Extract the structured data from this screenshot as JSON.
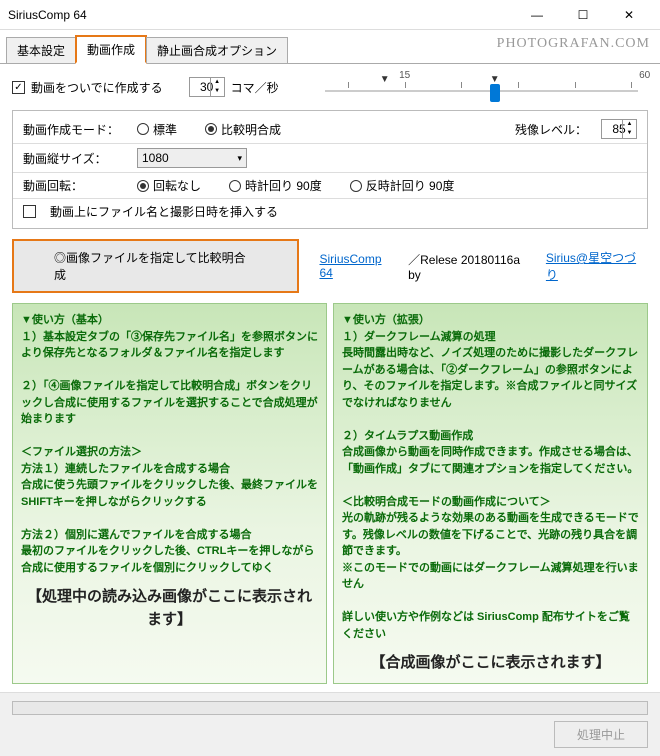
{
  "window": {
    "title": "SiriusComp 64"
  },
  "brand": "PHOTOGRAFAN.COM",
  "tabs": [
    "基本設定",
    "動画作成",
    "静止画合成オプション"
  ],
  "top": {
    "checkbox_label": "動画をついでに作成する",
    "fps_value": "30",
    "fps_unit": "コマ／秒"
  },
  "slider": {
    "labels": [
      "15",
      "60"
    ],
    "thumb_value": 30
  },
  "form": {
    "mode_label": "動画作成モード：",
    "mode_opts": [
      "標準",
      "比較明合成"
    ],
    "residue_label": "残像レベル：",
    "residue_value": "85",
    "size_label": "動画縦サイズ：",
    "size_value": "1080",
    "rotate_label": "動画回転：",
    "rotate_opts": [
      "回転なし",
      "時計回り 90度",
      "反時計回り 90度"
    ],
    "insert_label": "動画上にファイル名と撮影日時を挿入する"
  },
  "action": {
    "button": "◎画像ファイルを指定して比較明合成",
    "link1": "SiriusComp 64",
    "release": "／Relese 20180116a  by",
    "link2": "Sirius@星空つづり"
  },
  "left": {
    "head": "▼使い方（基本）",
    "l1": "１）基本設定タブの「③保存先ファイル名」を参照ボタンにより保存先となるフォルダ＆ファイル名を指定します",
    "l2": "２）「④画像ファイルを指定して比較明合成」ボタンをクリックし合成に使用するファイルを選択することで合成処理が始まります",
    "l3": "＜ファイル選択の方法＞",
    "l4": "方法１）連続したファイルを合成する場合",
    "l5": "合成に使う先頭ファイルをクリックした後、最終ファイルをSHIFTキーを押しながらクリックする",
    "l6": "方法２）個別に選んでファイルを合成する場合",
    "l7": "最初のファイルをクリックした後、CTRLキーを押しながら合成に使用するファイルを個別にクリックしてゆく",
    "box": "【処理中の読み込み画像がここに表示されます】"
  },
  "right": {
    "head": "▼使い方（拡張）",
    "r1": "１）ダークフレーム減算の処理",
    "r2": "長時間露出時など、ノイズ処理のために撮影したダークフレームがある場合は、「②ダークフレーム」の参照ボタンにより、そのファイルを指定します。※合成ファイルと同サイズでなければなりません",
    "r3": "２）タイムラプス動画作成",
    "r4": "合成画像から動画を同時作成できます。作成させる場合は、「動画作成」タブにて関連オプションを指定してください。",
    "r5": "＜比較明合成モードの動画作成について＞",
    "r6": "光の軌跡が残るような効果のある動画を生成できるモードです。残像レベルの数値を下げることで、光跡の残り具合を調節できます。",
    "r7": "※このモードでの動画にはダークフレーム減算処理を行いません",
    "r8": "詳しい使い方や作例などは SiriusComp 配布サイトをご覧ください",
    "box": "【合成画像がここに表示されます】"
  },
  "bottom": {
    "stop": "処理中止"
  }
}
